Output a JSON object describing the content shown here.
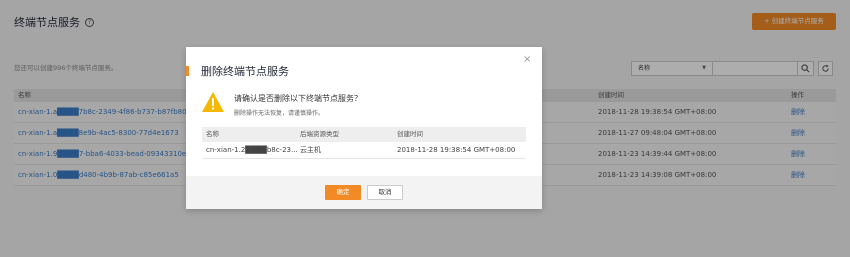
{
  "page": {
    "title": "终端节点服务",
    "create_button": "+ 创建终端节点服务",
    "quota_text": "您还可以创建996个终端节点服务。",
    "search": {
      "field": "名称",
      "placeholder": ""
    }
  },
  "table": {
    "headers": {
      "name": "名称",
      "created": "创建时间",
      "operation": "操作"
    },
    "rows": [
      {
        "name": "cn-xian-1.a████7b8c-2349-4f86-b737-b87fb80005",
        "created": "2018-11-28 19:38:54 GMT+08:00",
        "operation": "删除"
      },
      {
        "name": "cn-xian-1.a████8e9b-4ac5-8300-77d4e1673",
        "created": "2018-11-27 09:48:04 GMT+08:00",
        "operation": "删除"
      },
      {
        "name": "cn-xian-1.9████7-bba6-4033-bead-09343310e",
        "created": "2018-11-23 14:39:44 GMT+08:00",
        "operation": "删除"
      },
      {
        "name": "cn-xian-1.0████d480-4b9b-87ab-c85e661a5",
        "created": "2018-11-23 14:39:08 GMT+08:00",
        "operation": "删除"
      }
    ]
  },
  "dialog": {
    "title": "删除终端节点服务",
    "close": "×",
    "confirm_text": "请确认是否删除以下终端节点服务？",
    "sub_text": "删除操作无法恢复，请谨慎操作。",
    "headers": {
      "name": "名称",
      "backend_type": "后端资源类型",
      "created": "创建时间"
    },
    "row": {
      "name": "cn-xian-1.2████b8c-23...",
      "backend_type": "云主机",
      "created": "2018-11-28 19:38:54 GMT+08:00"
    },
    "ok": "确定",
    "cancel": "取消"
  },
  "colors": {
    "accent": "#f28b25",
    "link": "#3a7cc8",
    "warning": "#f5b800"
  }
}
